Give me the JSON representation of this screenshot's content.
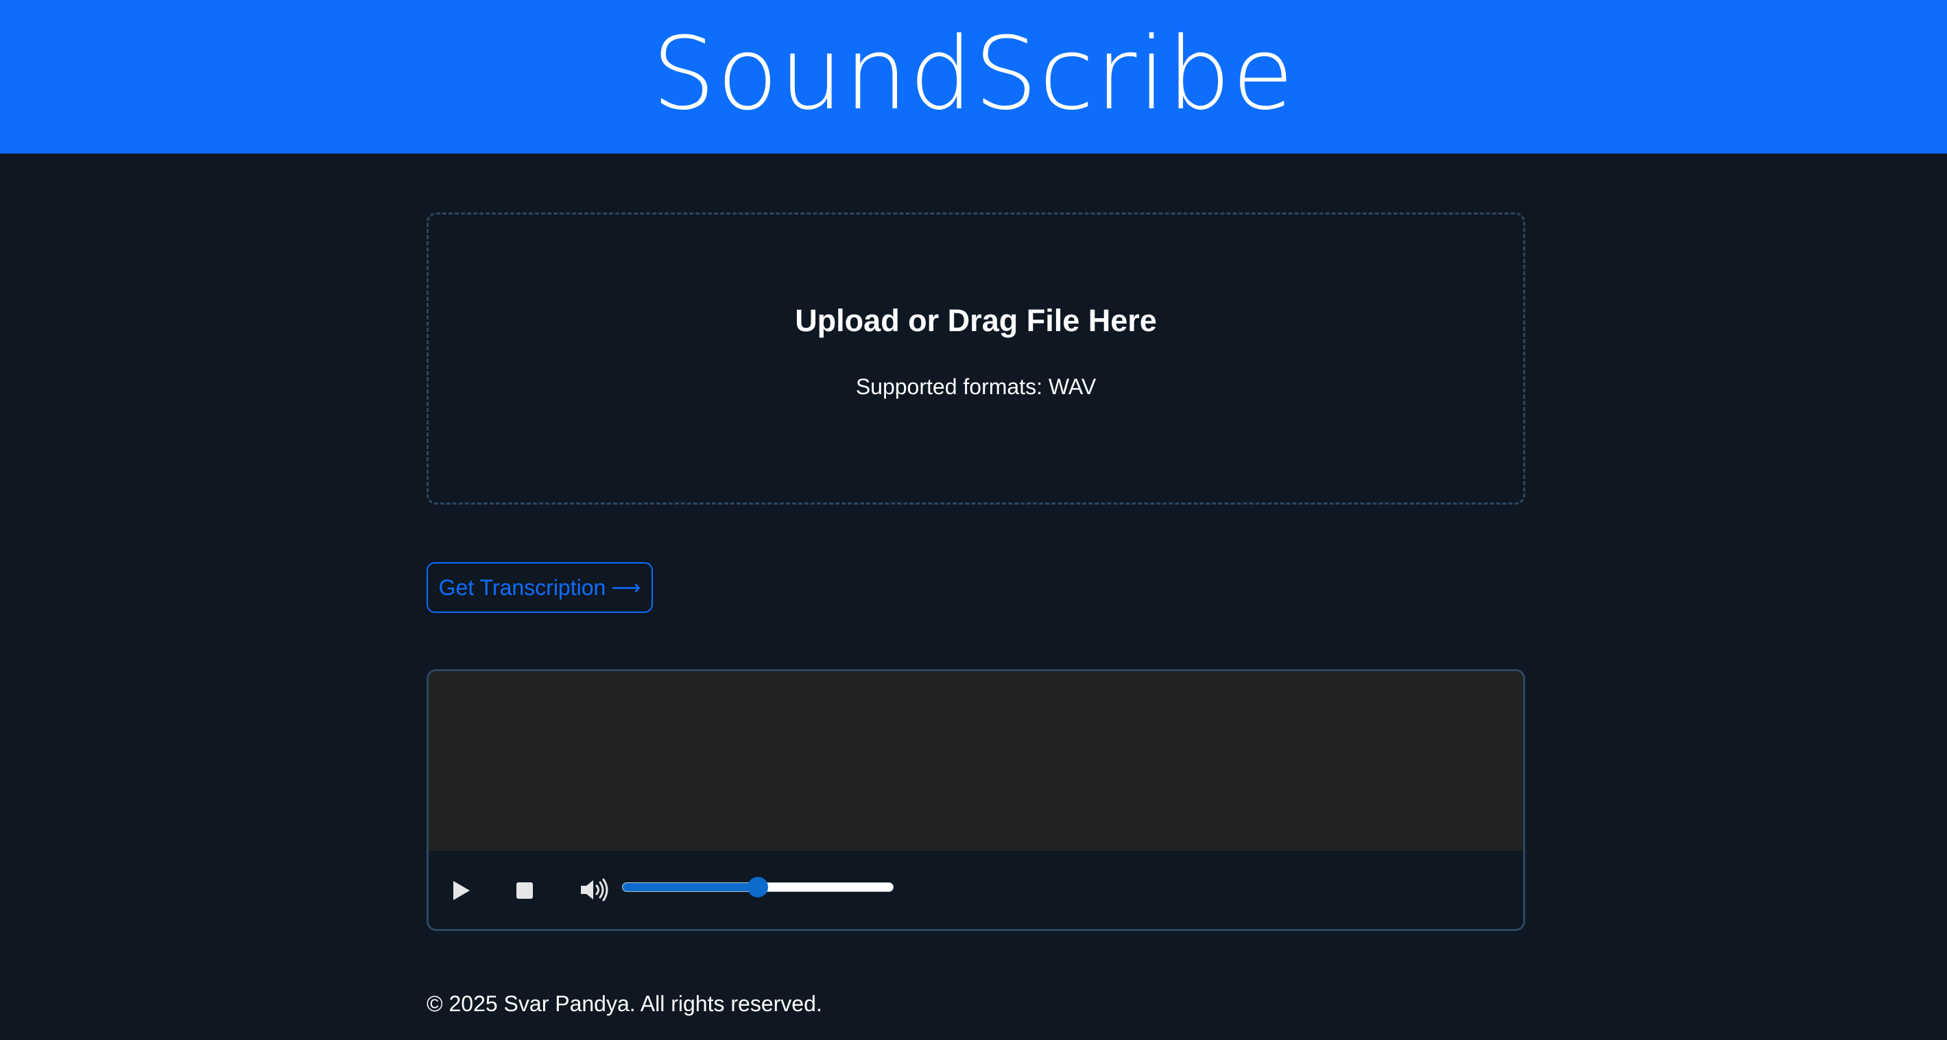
{
  "header": {
    "title": "SoundScribe",
    "background": "#0d6efd"
  },
  "upload": {
    "title": "Upload or Drag File Here",
    "subtitle": "Supported formats: WAV"
  },
  "actions": {
    "transcribe_label": "Get Transcription",
    "transcribe_arrow": "⟶"
  },
  "player": {
    "play_icon": "play-icon",
    "stop_icon": "stop-icon",
    "volume_icon": "volume-icon",
    "volume_level": 0.5
  },
  "footer": {
    "copyright": "© 2025 Svar Pandya. All rights reserved."
  },
  "colors": {
    "page_background": "#0f1723",
    "accent": "#0d6efd",
    "border": "#2c4763",
    "waveform_background": "#222222",
    "slider_fill": "#0d6ccb"
  }
}
